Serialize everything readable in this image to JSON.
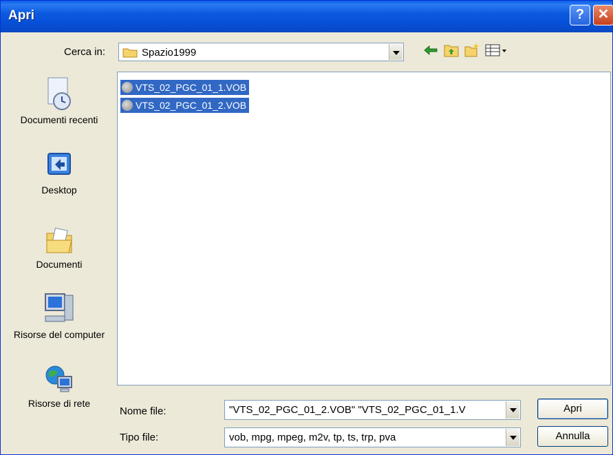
{
  "window": {
    "title": "Apri"
  },
  "lookin": {
    "label": "Cerca in:",
    "value": "Spazio1999"
  },
  "places": [
    {
      "label": "Documenti recenti"
    },
    {
      "label": "Desktop"
    },
    {
      "label": "Documenti"
    },
    {
      "label": "Risorse del computer"
    },
    {
      "label": "Risorse di rete"
    }
  ],
  "files": [
    {
      "name": "VTS_02_PGC_01_1.VOB"
    },
    {
      "name": "VTS_02_PGC_01_2.VOB"
    }
  ],
  "filename": {
    "label": "Nome file:",
    "value": "\"VTS_02_PGC_01_2.VOB\" \"VTS_02_PGC_01_1.V"
  },
  "filetype": {
    "label": "Tipo file:",
    "value": "vob, mpg, mpeg, m2v, tp, ts, trp, pva"
  },
  "buttons": {
    "open": "Apri",
    "cancel": "Annulla"
  }
}
